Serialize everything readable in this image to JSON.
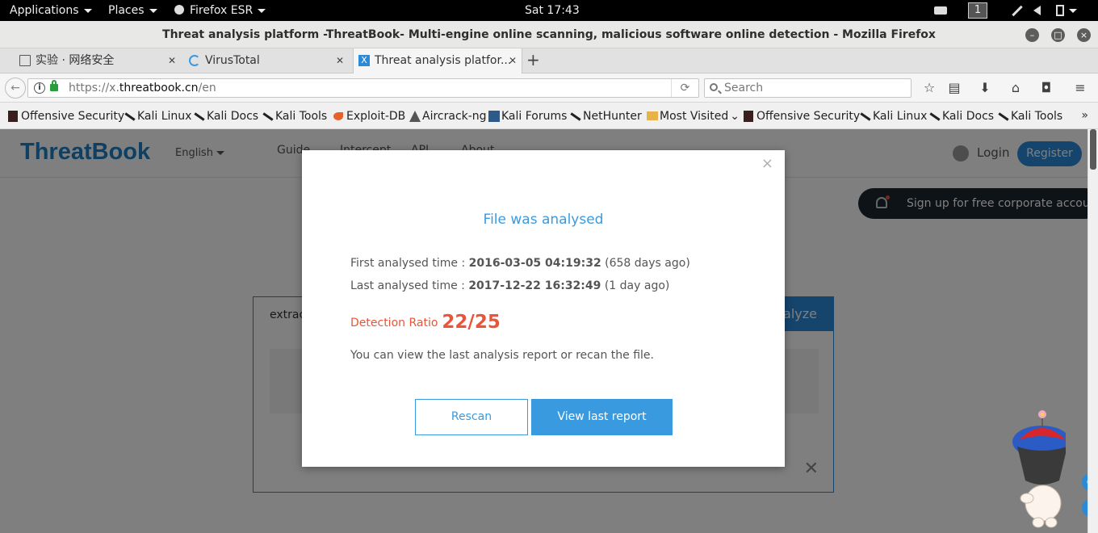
{
  "topbar": {
    "applications": "Applications",
    "places": "Places",
    "browser": "Firefox ESR",
    "clock": "Sat 17:43",
    "workspace": "1"
  },
  "window": {
    "title": "Threat analysis platform -ThreatBook- Multi-engine online scanning, malicious software online detection - Mozilla Firefox"
  },
  "tabs": [
    {
      "label": "实验 · 网络安全",
      "icon": "book-icon"
    },
    {
      "label": "VirusTotal",
      "icon": "loading-icon"
    },
    {
      "label": "Threat analysis platfor...",
      "icon": "threatbook-icon"
    }
  ],
  "nav": {
    "url_prefix": "https://x.",
    "url_domain": "threatbook.cn",
    "url_path": "/en",
    "search_placeholder": "Search"
  },
  "bookmarks": [
    "Offensive Security",
    "Kali Linux",
    "Kali Docs",
    "Kali Tools",
    "Exploit-DB",
    "Aircrack-ng",
    "Kali Forums",
    "NetHunter",
    "Most Visited",
    "Offensive Security",
    "Kali Linux",
    "Kali Docs",
    "Kali Tools"
  ],
  "site": {
    "logo": "ThreatBook",
    "language": "English",
    "nav": [
      "Guide",
      "Intercept",
      "API",
      "About"
    ],
    "login": "Login",
    "register": "Register",
    "corporate_banner": "Sign up for free corporate account",
    "upload_tab": "extrac",
    "analyze": "nalyze"
  },
  "modal": {
    "close": "×",
    "title": "File was analysed",
    "first_label": "First analysed time : ",
    "first_time": "2016-03-05 04:19:32",
    "first_ago": " (658 days ago)",
    "last_label": "Last analysed time : ",
    "last_time": "2017-12-22 16:32:49",
    "last_ago": " (1 day ago)",
    "ratio_label": "Detection Ratio",
    "ratio_value": "22/25",
    "note": "You can view the last analysis report or recan the file.",
    "rescan": "Rescan",
    "view_report": "View last report"
  },
  "colors": {
    "accent": "#3a9ae0",
    "danger": "#e8553a",
    "brand": "#1e7fc4"
  }
}
